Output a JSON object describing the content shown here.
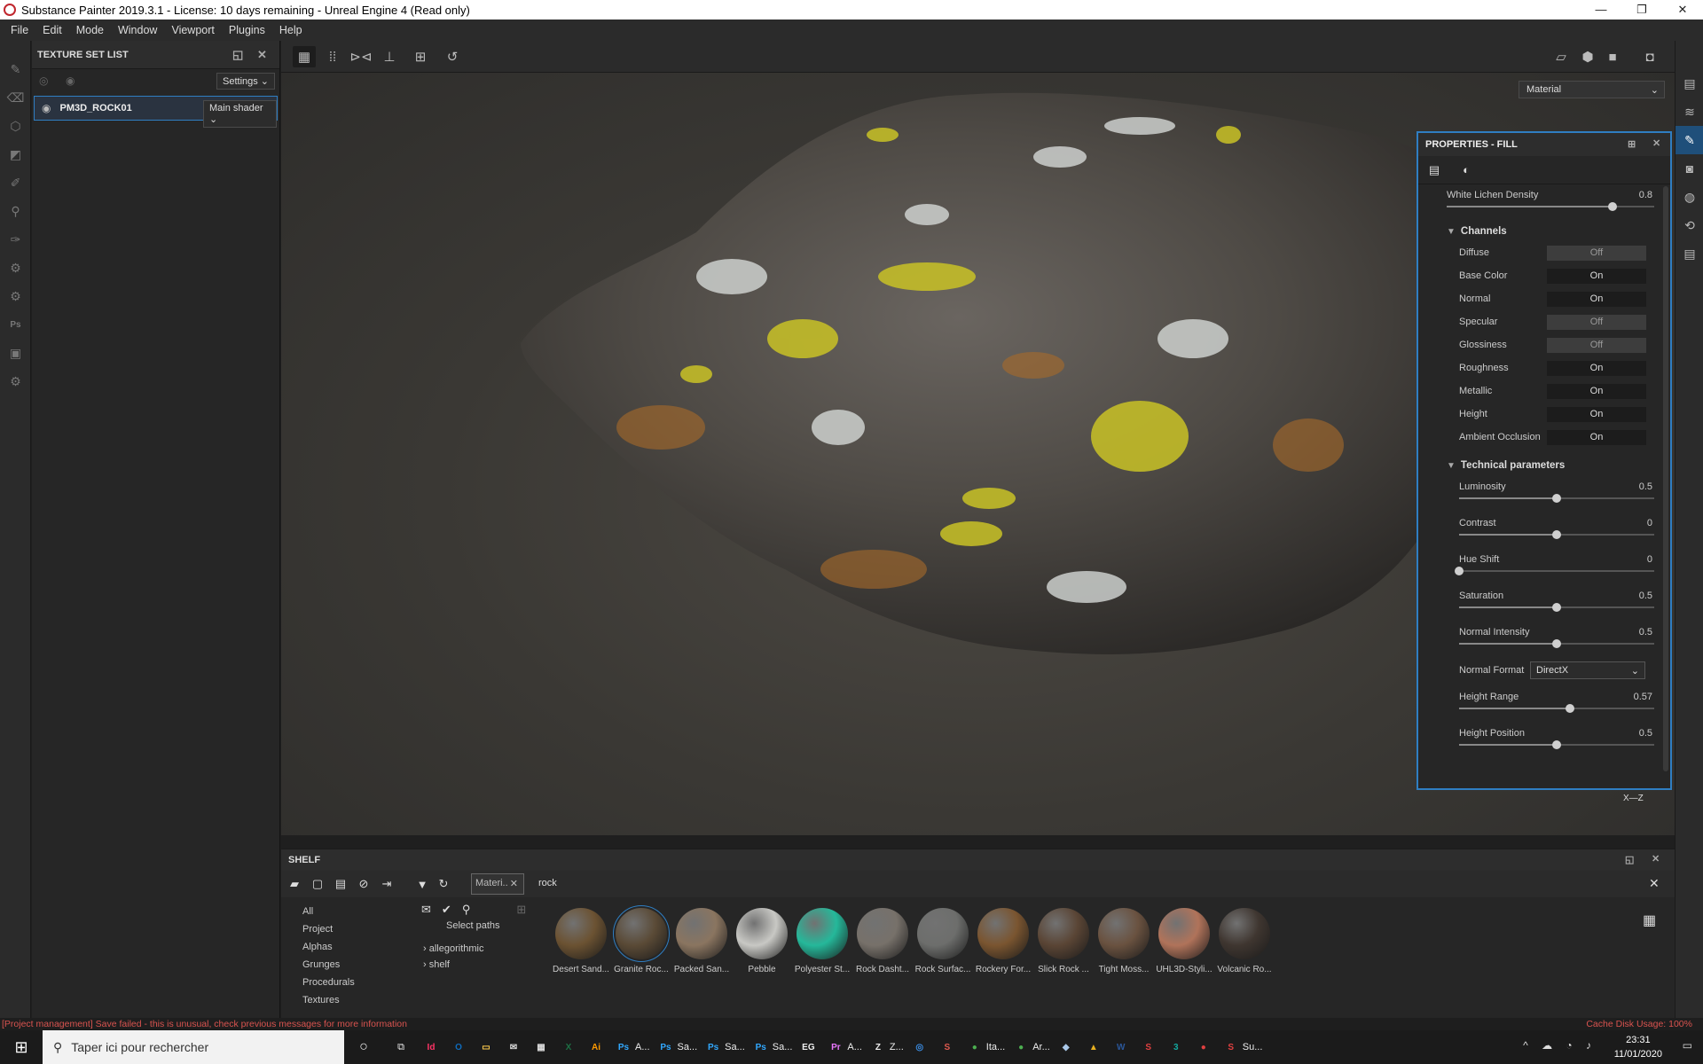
{
  "window": {
    "title": "Substance Painter 2019.3.1 - License: 10 days remaining - Unreal Engine 4 (Read only)"
  },
  "menu": [
    "File",
    "Edit",
    "Mode",
    "Window",
    "Viewport",
    "Plugins",
    "Help"
  ],
  "texture_set_list": {
    "title": "TEXTURE SET LIST",
    "settings_label": "Settings",
    "item_name": "PM3D_ROCK01",
    "shader_label": "Main shader"
  },
  "viewport": {
    "mode_select": "Material",
    "axis_label": "X—Z"
  },
  "properties": {
    "title": "PROPERTIES - FILL",
    "white_lichen": {
      "label": "White Lichen Density",
      "value": "0.8",
      "level": 0.8
    },
    "channels_title": "Channels",
    "channels": [
      {
        "name": "Diffuse",
        "state": "Off"
      },
      {
        "name": "Base Color",
        "state": "On"
      },
      {
        "name": "Normal",
        "state": "On"
      },
      {
        "name": "Specular",
        "state": "Off"
      },
      {
        "name": "Glossiness",
        "state": "Off"
      },
      {
        "name": "Roughness",
        "state": "On"
      },
      {
        "name": "Metallic",
        "state": "On"
      },
      {
        "name": "Height",
        "state": "On"
      },
      {
        "name": "Ambient Occlusion",
        "state": "On"
      }
    ],
    "tech_title": "Technical parameters",
    "tech": [
      {
        "label": "Luminosity",
        "value": "0.5",
        "level": 0.5
      },
      {
        "label": "Contrast",
        "value": "0",
        "level": 0.5
      },
      {
        "label": "Hue Shift",
        "value": "0",
        "level": 0.0
      },
      {
        "label": "Saturation",
        "value": "0.5",
        "level": 0.5
      },
      {
        "label": "Normal Intensity",
        "value": "0.5",
        "level": 0.5
      }
    ],
    "normal_format": {
      "label": "Normal Format",
      "value": "DirectX"
    },
    "tech2": [
      {
        "label": "Height Range",
        "value": "0.57",
        "level": 0.57
      },
      {
        "label": "Height Position",
        "value": "0.5",
        "level": 0.5
      }
    ]
  },
  "shelf": {
    "title": "SHELF",
    "filter_chip": "Materi..",
    "search_value": "rock",
    "categories": [
      "All",
      "Project",
      "Alphas",
      "Grunges",
      "Procedurals",
      "Textures"
    ],
    "select_paths": "Select paths",
    "paths": [
      "allegorithmic",
      "shelf"
    ],
    "materials": [
      {
        "label": "Desert Sand...",
        "color": "#6b5232"
      },
      {
        "label": "Granite Roc...",
        "color": "#5a4a36"
      },
      {
        "label": "Packed San...",
        "color": "#8a7560"
      },
      {
        "label": "Pebble",
        "color": "#c8c8c4"
      },
      {
        "label": "Polyester St...",
        "color": "#25b89a"
      },
      {
        "label": "Rock Dasht...",
        "color": "#77716a"
      },
      {
        "label": "Rock Surfac...",
        "color": "#6d6e6c"
      },
      {
        "label": "Rockery For...",
        "color": "#7a5530"
      },
      {
        "label": "Slick Rock ...",
        "color": "#5a4535"
      },
      {
        "label": "Tight Moss...",
        "color": "#6a5240"
      },
      {
        "label": "UHL3D-Styli...",
        "color": "#b0735a"
      },
      {
        "label": "Volcanic Ro...",
        "color": "#3f3630"
      }
    ]
  },
  "status": {
    "message": "[Project management] Save failed - this is unusual, check previous messages for more information",
    "cache": "Cache Disk Usage: 100%"
  },
  "taskbar": {
    "search_placeholder": "Taper ici pour rechercher",
    "apps": [
      {
        "icon": "Id",
        "color": "#ff3366",
        "label": ""
      },
      {
        "icon": "O",
        "color": "#0f6cbd",
        "label": ""
      },
      {
        "icon": "▭",
        "color": "#ffcc4d",
        "label": ""
      },
      {
        "icon": "✉",
        "color": "#dddddd",
        "label": ""
      },
      {
        "icon": "▦",
        "color": "#dddddd",
        "label": ""
      },
      {
        "icon": "X",
        "color": "#1d7044",
        "label": ""
      },
      {
        "icon": "Ai",
        "color": "#ff9a00",
        "label": ""
      },
      {
        "icon": "Ps",
        "color": "#31a8ff",
        "label": "A..."
      },
      {
        "icon": "Ps",
        "color": "#31a8ff",
        "label": "Sa..."
      },
      {
        "icon": "Ps",
        "color": "#31a8ff",
        "label": "Sa..."
      },
      {
        "icon": "Ps",
        "color": "#31a8ff",
        "label": "Sa..."
      },
      {
        "icon": "EG",
        "color": "#eeeeee",
        "label": ""
      },
      {
        "icon": "Pr",
        "color": "#ea77ff",
        "label": "A..."
      },
      {
        "icon": "Z",
        "color": "#eeeeee",
        "label": "Z..."
      },
      {
        "icon": "◎",
        "color": "#3a8ee6",
        "label": ""
      },
      {
        "icon": "S",
        "color": "#e05a4f",
        "label": ""
      },
      {
        "icon": "●",
        "color": "#4caf50",
        "label": "Ita..."
      },
      {
        "icon": "●",
        "color": "#4caf50",
        "label": "Ar..."
      },
      {
        "icon": "◆",
        "color": "#aac8e8",
        "label": ""
      },
      {
        "icon": "▲",
        "color": "#e8b020",
        "label": ""
      },
      {
        "icon": "W",
        "color": "#2b579a",
        "label": ""
      },
      {
        "icon": "S",
        "color": "#e04040",
        "label": ""
      },
      {
        "icon": "3",
        "color": "#13a89e",
        "label": ""
      },
      {
        "icon": "●",
        "color": "#e04040",
        "label": ""
      },
      {
        "icon": "S",
        "color": "#e04040",
        "label": "Su..."
      }
    ],
    "time": "23:31",
    "date": "11/01/2020"
  }
}
